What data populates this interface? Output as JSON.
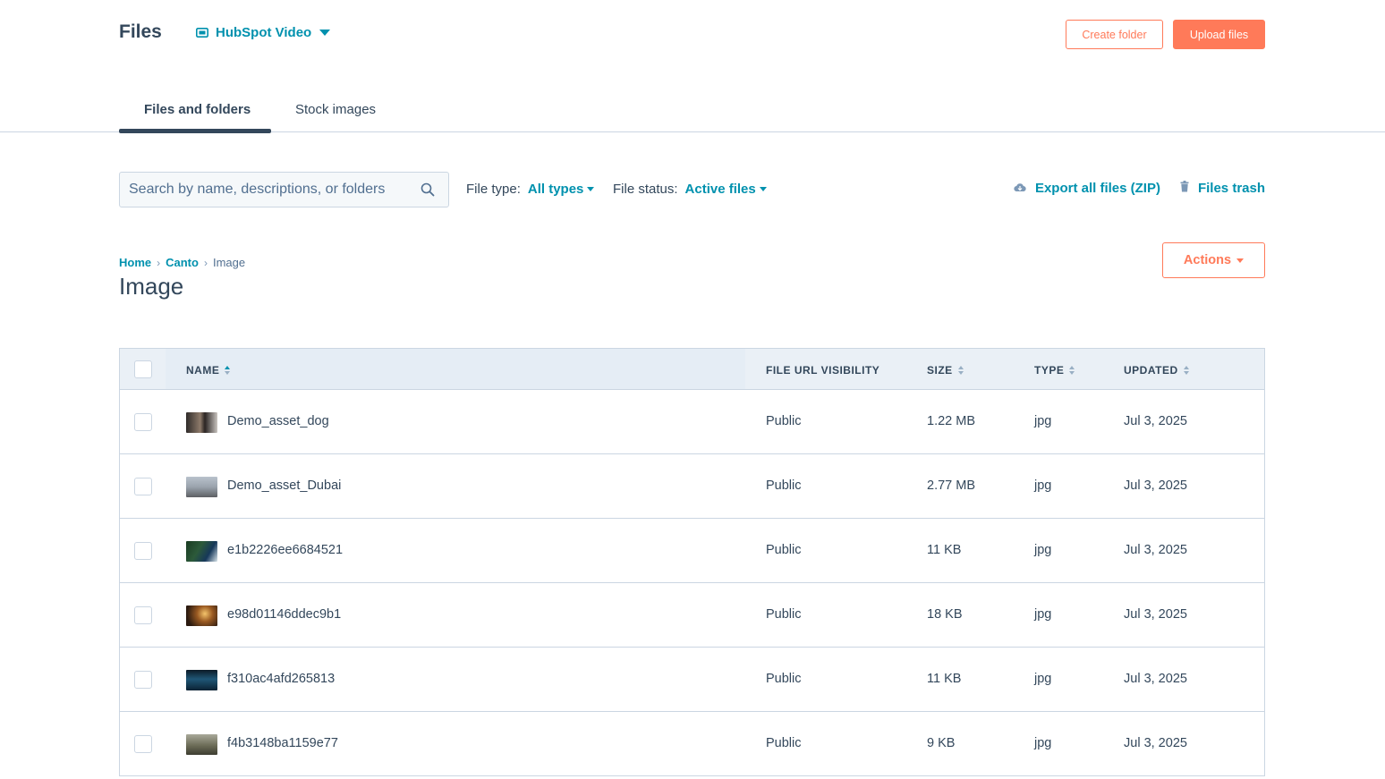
{
  "header": {
    "title": "Files",
    "account": "HubSpot Video",
    "create_folder": "Create folder",
    "upload_files": "Upload files"
  },
  "tabs": [
    {
      "label": "Files and folders",
      "active": true
    },
    {
      "label": "Stock images",
      "active": false
    }
  ],
  "toolbar": {
    "search_placeholder": "Search by name, descriptions, or folders",
    "file_type_label": "File type:",
    "file_type_value": "All types",
    "file_status_label": "File status:",
    "file_status_value": "Active files",
    "export_label": "Export all files (ZIP)",
    "trash_label": "Files trash"
  },
  "breadcrumb": {
    "items": [
      "Home",
      "Canto"
    ],
    "current": "Image"
  },
  "folder_title": "Image",
  "actions_label": "Actions",
  "table": {
    "columns": {
      "name": "NAME",
      "visibility": "FILE URL VISIBILITY",
      "size": "SIZE",
      "type": "TYPE",
      "updated": "UPDATED"
    },
    "rows": [
      {
        "name": "Demo_asset_dog",
        "visibility": "Public",
        "size": "1.22 MB",
        "type": "jpg",
        "updated": "Jul 3, 2025",
        "thumb": "#5a4a40"
      },
      {
        "name": "Demo_asset_Dubai",
        "visibility": "Public",
        "size": "2.77 MB",
        "type": "jpg",
        "updated": "Jul 3, 2025",
        "thumb": "#8f98a3"
      },
      {
        "name": "e1b2226ee6684521",
        "visibility": "Public",
        "size": "11 KB",
        "type": "jpg",
        "updated": "Jul 3, 2025",
        "thumb": "#1e3f50"
      },
      {
        "name": "e98d01146ddec9b1",
        "visibility": "Public",
        "size": "18 KB",
        "type": "jpg",
        "updated": "Jul 3, 2025",
        "thumb": "#6b4326"
      },
      {
        "name": "f310ac4afd265813",
        "visibility": "Public",
        "size": "11 KB",
        "type": "jpg",
        "updated": "Jul 3, 2025",
        "thumb": "#173a55"
      },
      {
        "name": "f4b3148ba1159e77",
        "visibility": "Public",
        "size": "9 KB",
        "type": "jpg",
        "updated": "Jul 3, 2025",
        "thumb": "#6d6d5c"
      }
    ]
  },
  "colors": {
    "accent": "#ff7a59",
    "link": "#0091ae",
    "text": "#33475b",
    "border": "#cbd6e2",
    "header_bg": "#eaf0f6"
  }
}
